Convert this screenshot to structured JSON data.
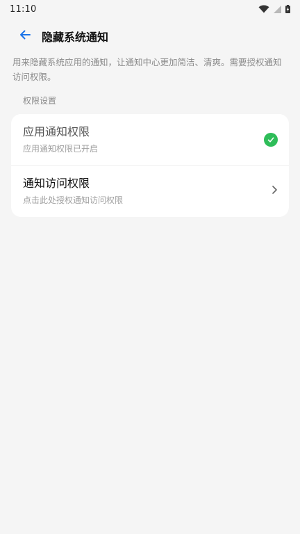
{
  "status_bar": {
    "time": "11:10",
    "icons": [
      "wifi-icon",
      "signal-icon",
      "battery-charging-icon"
    ]
  },
  "app_bar": {
    "back_icon": "arrow-left-icon",
    "title": "隐藏系统通知",
    "accent_color": "#1a73e8"
  },
  "description": "用来隐藏系统应用的通知，让通知中心更加简洁、清爽。需要授权通知访问权限。",
  "section": {
    "header": "权限设置",
    "items": [
      {
        "title": "应用通知权限",
        "subtitle": "应用通知权限已开启",
        "status": "granted",
        "end_icon": "check-circle-icon",
        "status_color": "#2ebd59"
      },
      {
        "title": "通知访问权限",
        "subtitle": "点击此处授权通知访问权限",
        "status": "not_granted",
        "end_icon": "chevron-right-icon"
      }
    ]
  }
}
